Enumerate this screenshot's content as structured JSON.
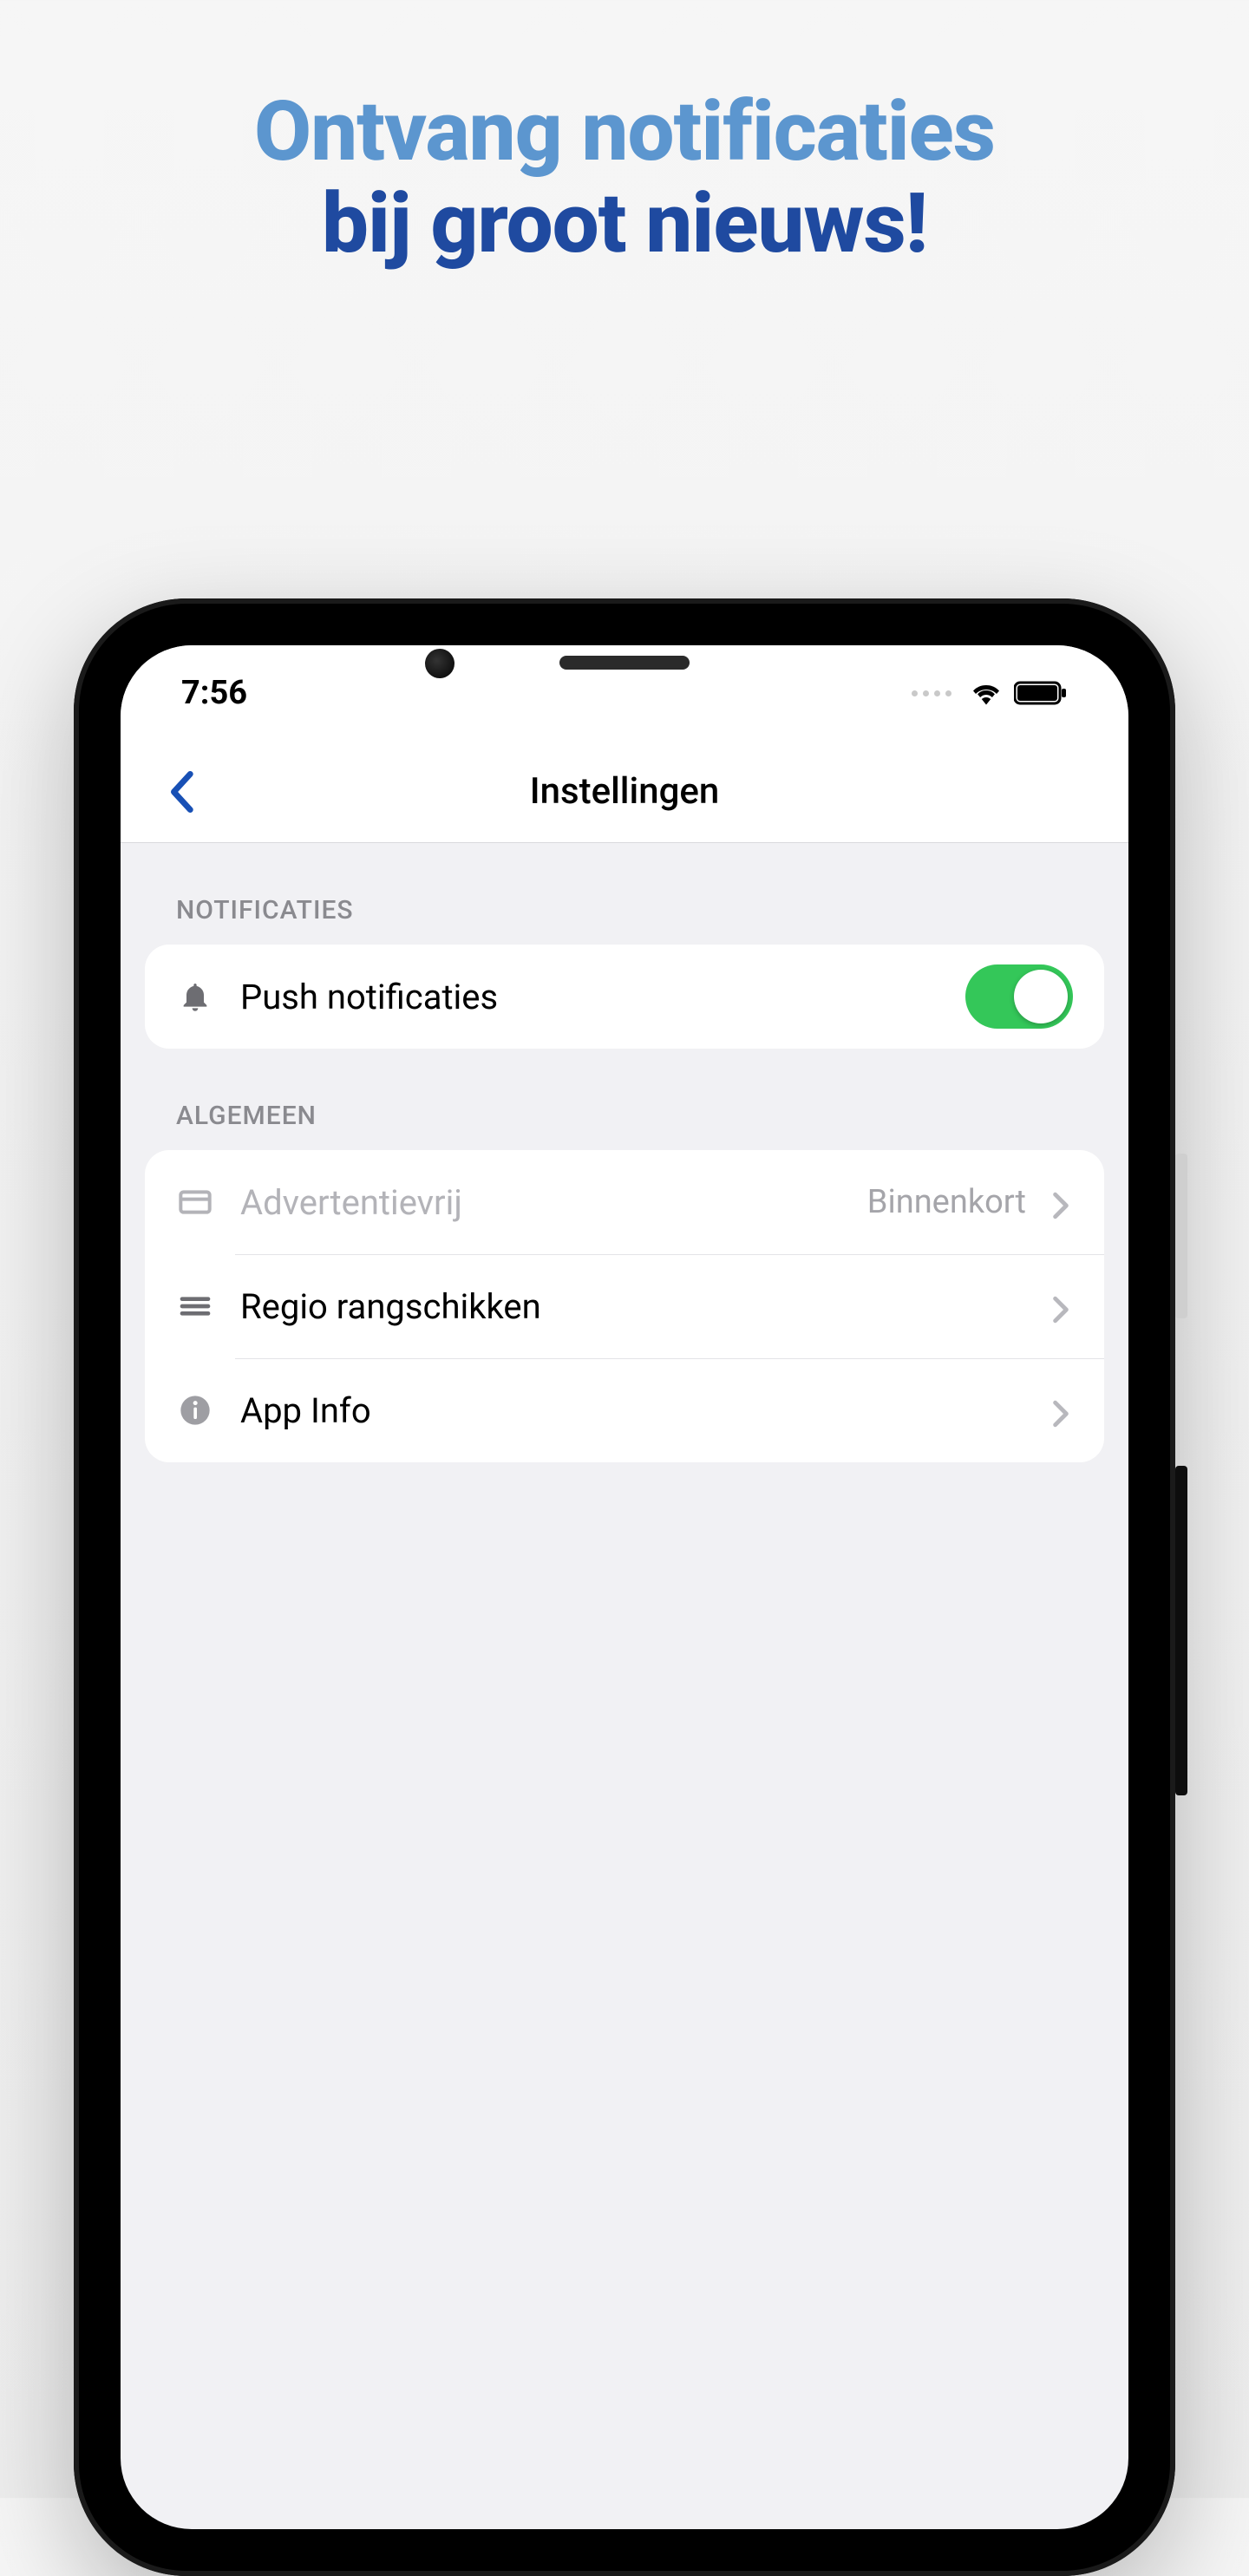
{
  "headline": {
    "line1": "Ontvang notificaties",
    "line2": "bij groot nieuws!"
  },
  "statusbar": {
    "time": "7:56"
  },
  "navbar": {
    "title": "Instellingen"
  },
  "sections": {
    "notifications": {
      "header": "NOTIFICATIES",
      "push_label": "Push notificaties",
      "push_on": true
    },
    "general": {
      "header": "ALGEMEEN",
      "adfree_label": "Advertentievrij",
      "adfree_value": "Binnenkort",
      "reorder_label": "Regio rangschikken",
      "appinfo_label": "App Info"
    }
  }
}
